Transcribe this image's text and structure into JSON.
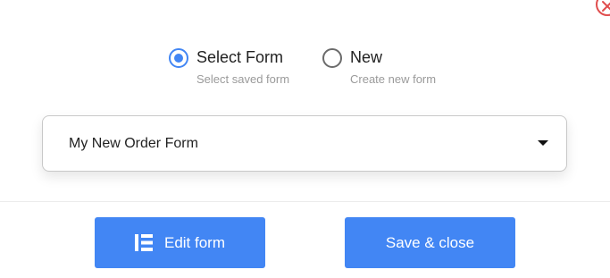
{
  "form_source": {
    "options": [
      {
        "label": "Select Form",
        "sublabel": "Select saved form",
        "selected": true
      },
      {
        "label": "New",
        "sublabel": "Create new form",
        "selected": false
      }
    ]
  },
  "form_select": {
    "value": "My New Order Form"
  },
  "actions": {
    "edit_label": "Edit form",
    "save_label": "Save & close"
  },
  "icons": {
    "close": "close-icon",
    "edit": "elementor-icon",
    "caret": "caret-down-icon"
  },
  "colors": {
    "accent": "#4286f4",
    "close": "#e04e4e"
  }
}
